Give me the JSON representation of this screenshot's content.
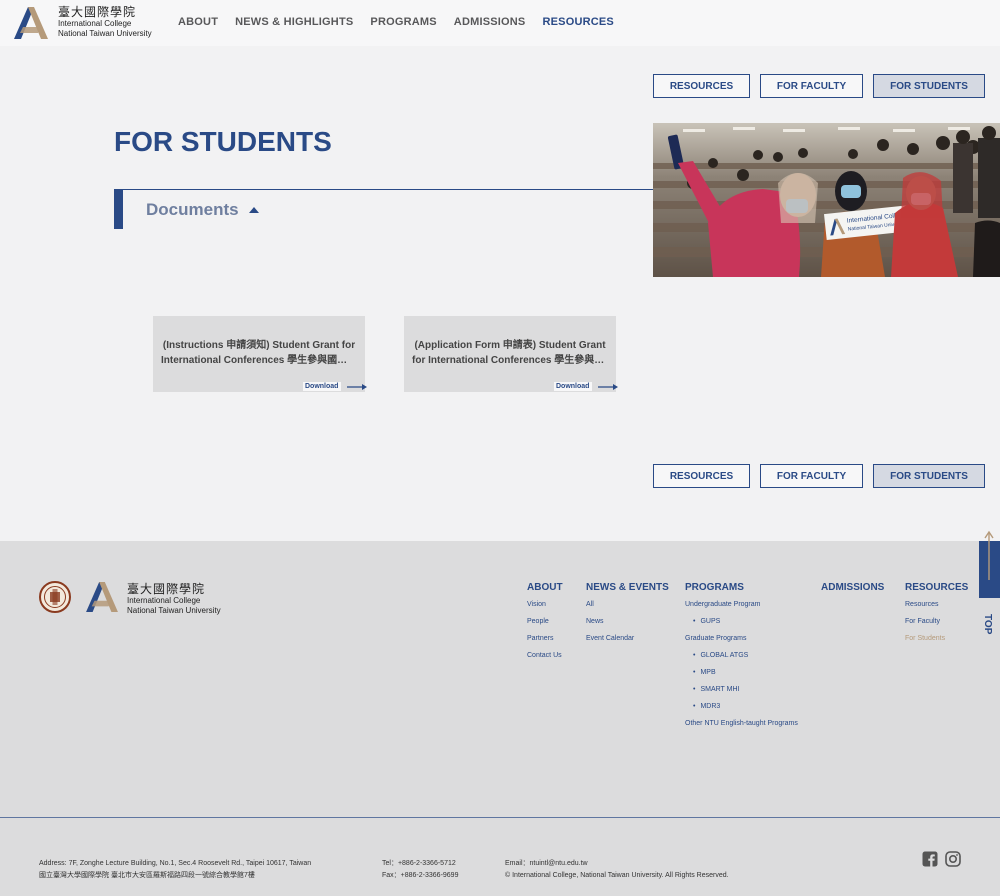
{
  "header": {
    "logo_cn": "臺大國際學院",
    "logo_en_1": "International College",
    "logo_en_2": "National Taiwan University",
    "nav": [
      "ABOUT",
      "NEWS & HIGHLIGHTS",
      "PROGRAMS",
      "ADMISSIONS",
      "RESOURCES"
    ],
    "nav_active": "RESOURCES"
  },
  "subtabs": [
    "RESOURCES",
    "FOR FACULTY",
    "FOR STUDENTS"
  ],
  "subtab_active": "FOR STUDENTS",
  "page_title": "FOR STUDENTS",
  "hero": {
    "sign_line_1": "International College",
    "sign_line_2": "National Taiwan University"
  },
  "documents": {
    "label": "Documents",
    "cards": [
      {
        "title_1": "(Instructions 申請須知) Student Grant for",
        "title_2": "International Conferences 學生參與國際會議補助",
        "action": "Download"
      },
      {
        "title_1": "(Application Form 申請表) Student Grant",
        "title_2": "for International Conferences 學生參與國際會議補助",
        "action": "Download"
      }
    ]
  },
  "footer": {
    "columns": [
      {
        "head": "ABOUT",
        "items": [
          "Vision",
          "People",
          "Partners",
          "Contact Us"
        ]
      },
      {
        "head": "NEWS & EVENTS",
        "items": [
          "All",
          "News",
          "Event Calendar"
        ]
      },
      {
        "head": "PROGRAMS",
        "items": [
          "Undergraduate Program",
          "GUPS",
          "Graduate Programs",
          "GLOBAL ATGS",
          "MPB",
          "SMART MHI",
          "MDR3",
          "Other NTU English-taught Programs"
        ]
      },
      {
        "head": "ADMISSIONS",
        "items": []
      },
      {
        "head": "RESOURCES",
        "items": [
          "Resources",
          "For Faculty",
          "For Students"
        ]
      }
    ],
    "address_en": "Address: 7F, Zonghe Lecture Building, No.1, Sec.4 Roosevelt Rd., Taipei 10617, Taiwan",
    "address_cn": "國立臺灣大學國際學院 臺北市大安區羅斯福路四段一號綜合教學館7樓",
    "tel": "Tel：+886-2-3366-5712",
    "fax": "Fax：+886-2-3366-9699",
    "email": "Email：ntuintl@ntu.edu.tw",
    "copyright": "© International College, National Taiwan University. All Rights Reserved."
  },
  "top_button": "TOP",
  "colors": {
    "brand_blue": "#2a4a86",
    "accent_tan": "#b59a7a",
    "footer_bg": "#dcdcdd",
    "page_bg": "#f2f2f3"
  }
}
